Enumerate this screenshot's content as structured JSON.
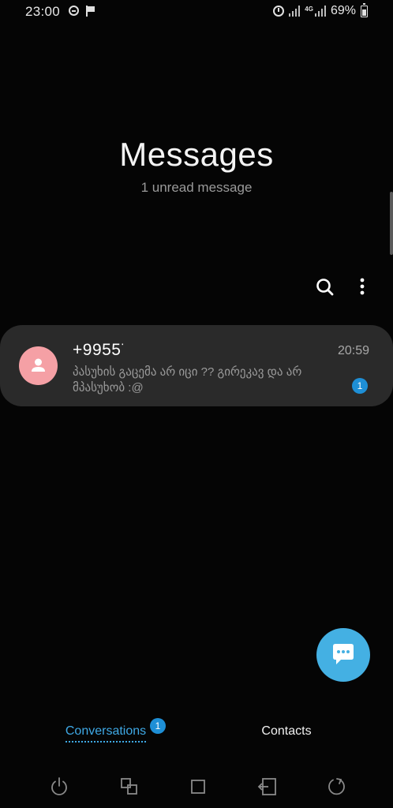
{
  "status_bar": {
    "time": "23:00",
    "battery": "69%",
    "network": "4G"
  },
  "header": {
    "title": "Messages",
    "subtitle": "1 unread message"
  },
  "conversations": [
    {
      "sender": "+99557",
      "time": "20:59",
      "preview": "პასუხის გაცემა არ იცი ?? გირეკავ და არ მპასუხობ :@",
      "unread_count": "1"
    }
  ],
  "tabs": {
    "conversations_label": "Conversations",
    "conversations_badge": "1",
    "contacts_label": "Contacts"
  },
  "icons": {
    "search": "search-icon",
    "more": "more-vertical-icon",
    "avatar": "person-icon",
    "fab": "chat-bubble-icon",
    "nav_power": "power-icon",
    "nav_recents": "recent-apps-icon",
    "nav_home": "home-icon",
    "nav_back": "back-icon",
    "nav_rotate": "rotate-icon"
  },
  "colors": {
    "accent": "#3fa9e6",
    "badge": "#1e8fd6",
    "fab": "#44b0e3",
    "avatar": "#f5a0a5",
    "card": "#2a2a2a"
  }
}
